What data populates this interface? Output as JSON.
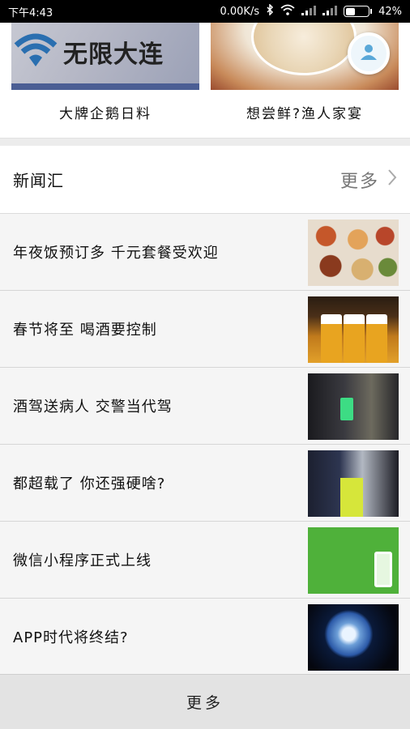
{
  "status_bar": {
    "time": "下午4:43",
    "network_speed": "0.00K/s",
    "battery_percent": "42%",
    "battery_level": 0.42
  },
  "features": [
    {
      "logo_text": "无限大连",
      "caption": "大牌企鹅日料"
    },
    {
      "caption": "想尝鲜?渔人家宴"
    }
  ],
  "section": {
    "title": "新闻汇",
    "more_label": "更多"
  },
  "news": [
    {
      "headline": "年夜饭预订多 千元套餐受欢迎"
    },
    {
      "headline": "春节将至 喝酒要控制"
    },
    {
      "headline": "酒驾送病人 交警当代驾"
    },
    {
      "headline": "都超载了 你还强硬啥?"
    },
    {
      "headline": "微信小程序正式上线"
    },
    {
      "headline": "APP时代将终结?"
    }
  ],
  "bottom_bar": {
    "more_label": "更多"
  },
  "colors": {
    "accent_blue": "#2a6fb0",
    "wechat_green": "#4fb13a"
  }
}
